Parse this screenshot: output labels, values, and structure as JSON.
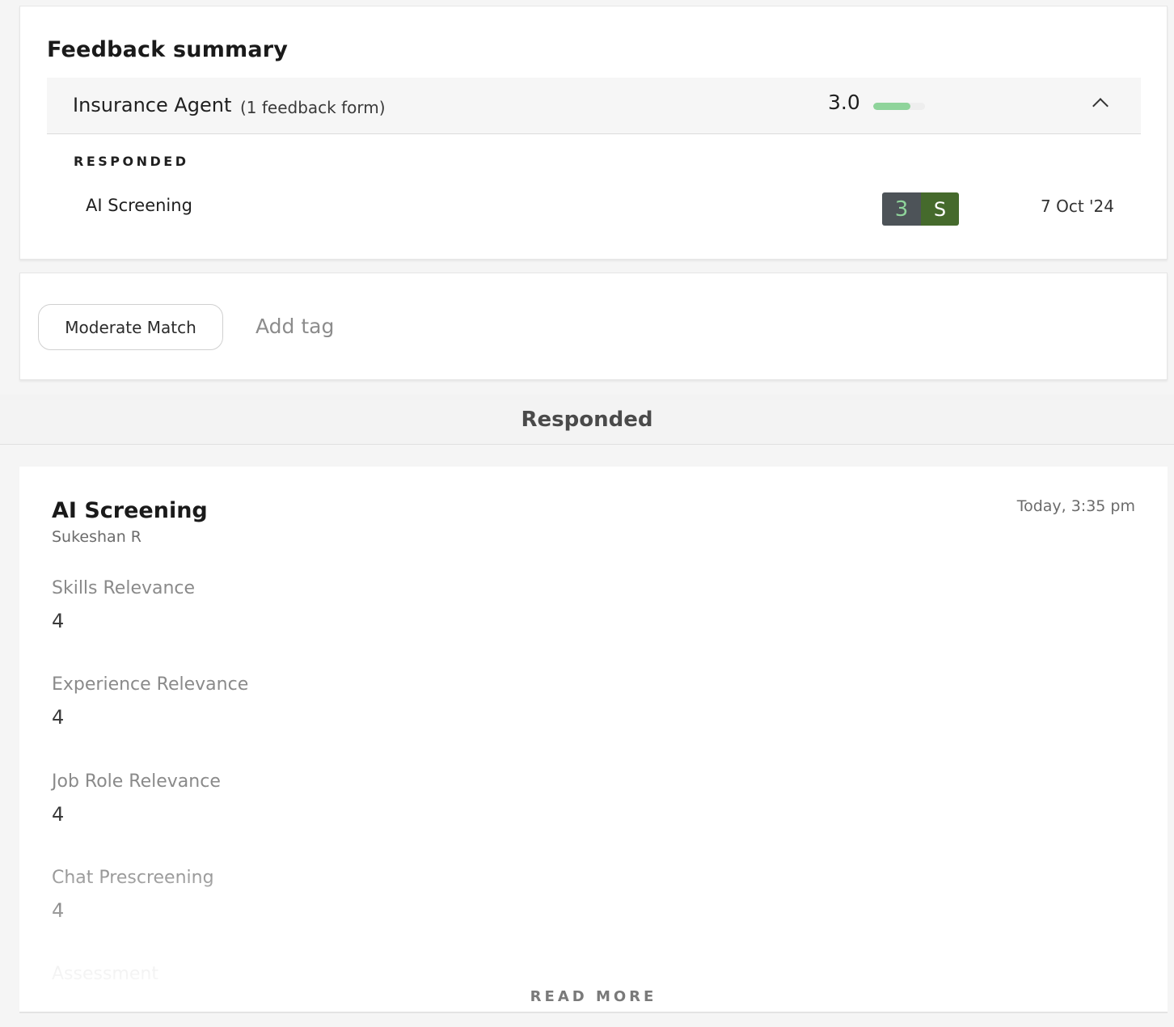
{
  "summary": {
    "title": "Feedback summary",
    "group": {
      "name": "Insurance Agent",
      "count_label": "(1 feedback form)",
      "score": "3.0",
      "score_fraction": 0.72,
      "chevron_icon": "chevron-up-icon"
    },
    "section_label": "RESPONDED",
    "rows": [
      {
        "name": "AI Screening",
        "rating": "3",
        "initial": "S",
        "date": "7 Oct '24"
      }
    ]
  },
  "tags": {
    "items": [
      "Moderate Match"
    ],
    "add_placeholder": "Add tag"
  },
  "responded_band": {
    "title": "Responded"
  },
  "detail": {
    "title": "AI Screening",
    "author": "Sukeshan R",
    "time": "Today, 3:35 pm",
    "questions": [
      {
        "label": "Skills Relevance",
        "value": "4"
      },
      {
        "label": "Experience Relevance",
        "value": "4"
      },
      {
        "label": "Job Role Relevance",
        "value": "4"
      },
      {
        "label": "Chat Prescreening",
        "value": "4"
      },
      {
        "label": "Assessment",
        "value": ""
      }
    ],
    "read_more": "READ MORE"
  },
  "colors": {
    "score_fill": "#8fd49b",
    "badge_dark": "#4d5358",
    "badge_green": "#456a2c"
  }
}
